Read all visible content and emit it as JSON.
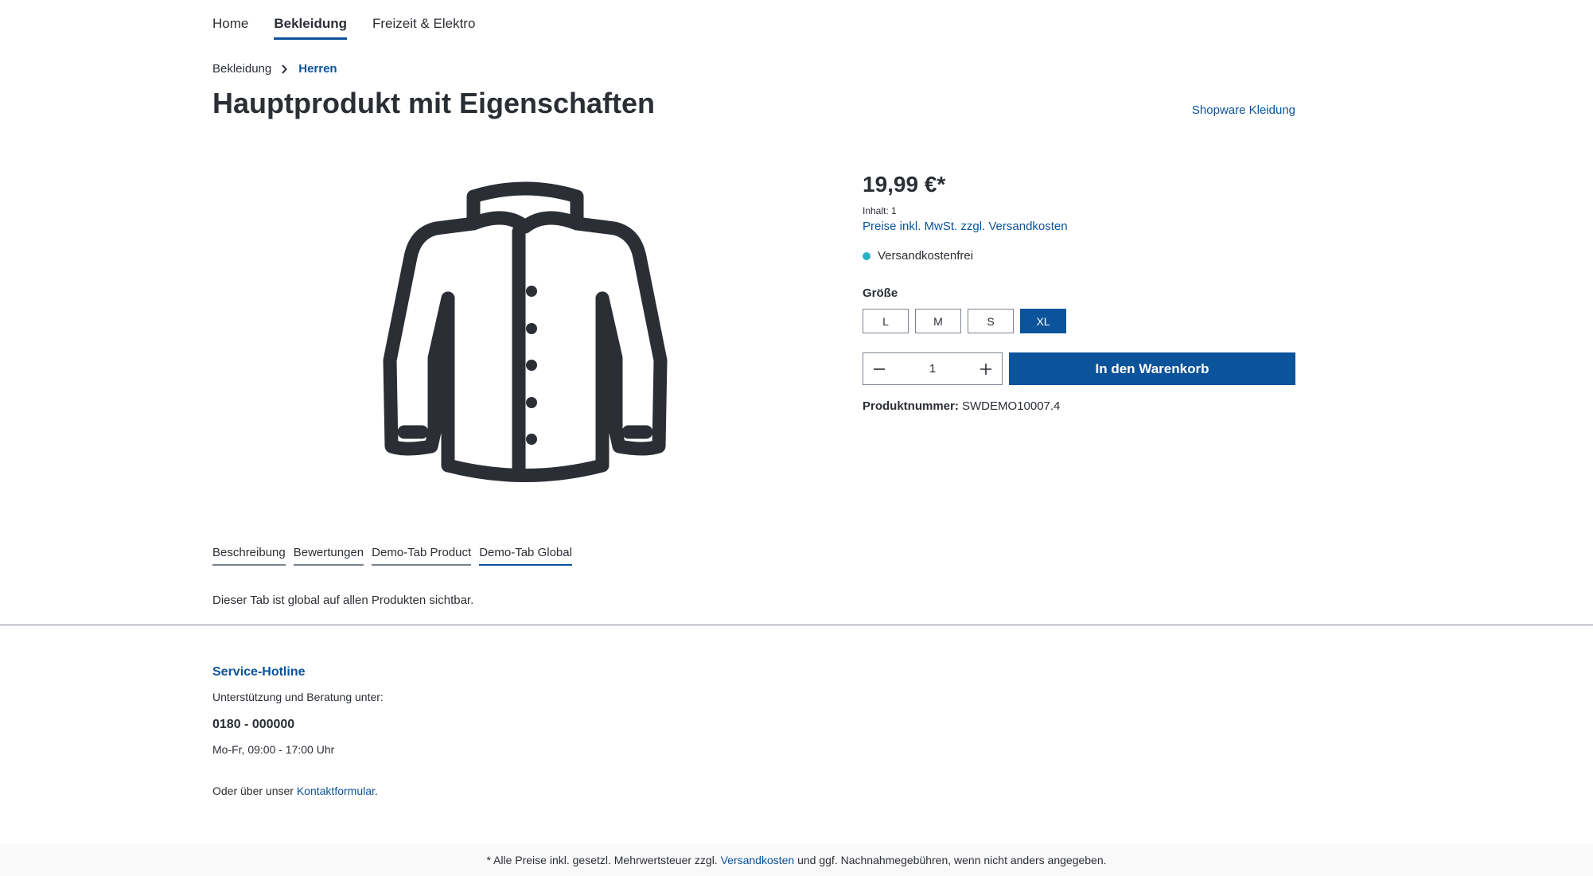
{
  "nav": {
    "items": [
      {
        "label": "Home",
        "active": false
      },
      {
        "label": "Bekleidung",
        "active": true
      },
      {
        "label": "Freizeit & Elektro",
        "active": false
      }
    ]
  },
  "breadcrumb": {
    "items": [
      "Bekleidung",
      "Herren"
    ]
  },
  "product": {
    "title": "Hauptprodukt mit Eigenschaften",
    "manufacturer": "Shopware Kleidung",
    "image_icon": "jacket-icon",
    "price": "19,99 €*",
    "content_label": "Inhalt: 1",
    "tax_link": "Preise inkl. MwSt. zzgl. Versandkosten",
    "delivery": "Versandkostenfrei",
    "variant_label": "Größe",
    "sizes": [
      {
        "label": "L",
        "selected": false
      },
      {
        "label": "M",
        "selected": false
      },
      {
        "label": "S",
        "selected": false
      },
      {
        "label": "XL",
        "selected": true
      }
    ],
    "quantity": "1",
    "add_to_cart": "In den Warenkorb",
    "number_label": "Produktnummer:",
    "number_value": "SWDEMO10007.4"
  },
  "tabs": {
    "items": [
      {
        "label": "Beschreibung",
        "active": false
      },
      {
        "label": "Bewertungen",
        "active": false
      },
      {
        "label": "Demo-Tab Product",
        "active": false
      },
      {
        "label": "Demo-Tab Global",
        "active": true
      }
    ],
    "content": "Dieser Tab ist global auf allen Produkten sichtbar."
  },
  "service": {
    "title": "Service-Hotline",
    "text": "Unterstützung und Beratung unter:",
    "phone": "0180 - 000000",
    "hours": "Mo-Fr, 09:00 - 17:00 Uhr",
    "contact_prefix": "Oder über unser ",
    "contact_link": "Kontaktformular",
    "contact_suffix": "."
  },
  "footer": {
    "prefix": "* Alle Preise inkl. gesetzl. Mehrwertsteuer zzgl. ",
    "link": "Versandkosten",
    "suffix": " und ggf. Nachnahmegebühren, wenn nicht anders angegeben."
  },
  "colors": {
    "brand": "#0b539b",
    "text": "#2b2f35",
    "delivery_dot": "#26b1c6"
  }
}
